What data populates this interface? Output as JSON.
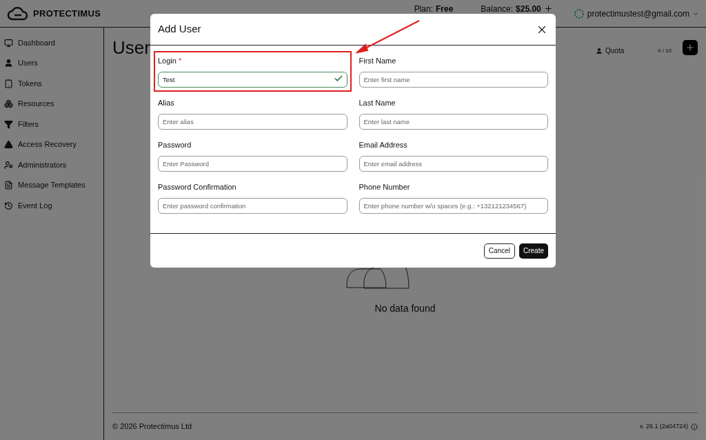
{
  "header": {
    "brand": "PROTECTIMUS",
    "plan_label": "Plan:",
    "plan": "Free",
    "balance_label": "Balance:",
    "balance": "$25.00",
    "account": "protectimustest@gmail.com"
  },
  "sidebar": {
    "items": [
      {
        "label": "Dashboard"
      },
      {
        "label": "Users"
      },
      {
        "label": "Tokens"
      },
      {
        "label": "Resources"
      },
      {
        "label": "Filters"
      },
      {
        "label": "Access Recovery"
      },
      {
        "label": "Administrators"
      },
      {
        "label": "Message Templates"
      },
      {
        "label": "Event Log"
      }
    ]
  },
  "page": {
    "title": "User",
    "quota_label": "Quota",
    "quota": "0 / 10",
    "empty": "No data found"
  },
  "footer": {
    "copyright": "© 2026 Protectimus Ltd",
    "version": "v. 26.1 (2a04724)"
  },
  "dialog": {
    "title": "Add User",
    "fields": [
      {
        "label": "Login",
        "required": true,
        "value": "Test",
        "valid": true,
        "highlighted": true
      },
      {
        "label": "First Name",
        "required": false,
        "placeholder": "Enter first name",
        "valid": false,
        "highlighted": false
      },
      {
        "label": "Alias",
        "required": false,
        "placeholder": "Enter alias",
        "valid": false,
        "highlighted": false
      },
      {
        "label": "Last Name",
        "required": false,
        "placeholder": "Enter last name",
        "valid": false,
        "highlighted": false
      },
      {
        "label": "Password",
        "required": false,
        "placeholder": "Enter Password",
        "valid": false,
        "highlighted": false
      },
      {
        "label": "Email Address",
        "required": false,
        "placeholder": "Enter email address",
        "valid": false,
        "highlighted": false
      },
      {
        "label": "Password Confirmation",
        "required": false,
        "placeholder": "Enter password confirmation",
        "valid": false,
        "highlighted": false
      },
      {
        "label": "Phone Number",
        "required": false,
        "placeholder": "Enter phone number w/o spaces (e.g.: +132121234567)",
        "valid": false,
        "highlighted": false
      }
    ],
    "required_mark": "*",
    "buttons": [
      {
        "label": "Cancel",
        "kind": "secondary"
      },
      {
        "label": "Create",
        "kind": "primary"
      }
    ]
  }
}
